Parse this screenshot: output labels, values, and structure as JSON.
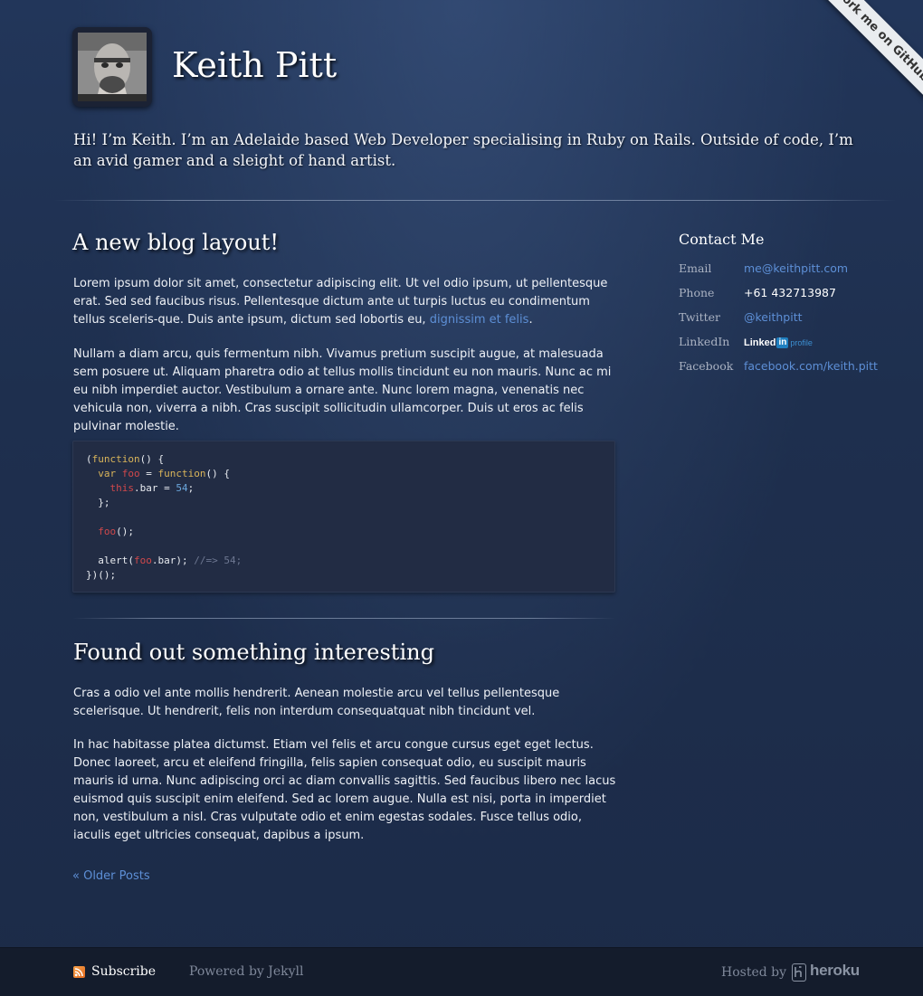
{
  "header": {
    "name": "Keith Pitt",
    "intro": "Hi! I’m Keith. I’m an Adelaide based Web Developer specialising in Ruby on Rails. Outside of code, I’m an avid gamer and a sleight of hand artist.",
    "fork_ribbon": "Fork me on GitHub"
  },
  "posts": [
    {
      "title": "A new blog layout!",
      "para1_text": "Lorem ipsum dolor sit amet, consectetur adipiscing elit. Ut vel odio ipsum, ut pellentesque erat. Sed sed faucibus risus. Pellentesque dictum ante ut turpis luctus eu condimentum tellus sceleris-que. Duis ante ipsum, dictum sed lobortis eu, ",
      "para1_link": "dignissim et felis",
      "para1_end": ".",
      "para2": "Nullam a diam arcu, quis fermentum nibh. Vivamus pretium suscipit augue, at malesuada sem posuere ut. Aliquam pharetra odio at tellus mollis tincidunt eu non mauris. Nunc ac mi eu nibh imperdiet auctor. Vestibulum a ornare ante. Nunc lorem magna, venenatis nec vehicula non, viverra a nibh. Cras suscipit sollicitudin ullamcorper. Duis ut eros ac felis pulvinar molestie."
    },
    {
      "title": "Found out something interesting",
      "para1": "Cras a odio vel ante mollis hendrerit. Aenean molestie arcu vel tellus pellentesque scelerisque. Ut hendrerit, felis non interdum consequatquat nibh tincidunt vel.",
      "para2": "In hac habitasse platea dictumst. Etiam vel felis et arcu congue cursus eget eget lectus. Donec laoreet, arcu et eleifend fringilla, felis sapien consequat odio, eu suscipit mauris mauris id urna. Nunc adipiscing orci ac diam convallis sagittis. Sed faucibus libero nec lacus euismod quis suscipit enim eleifend. Sed ac lorem augue. Nulla est nisi, porta in imperdiet non, vestibulum a nisl. Cras vulputate odio et enim egestas sodales. Fusce tellus odio, iaculis eget ultricies consequat, dapibus a ipsum."
    }
  ],
  "code": {
    "l1_open": "(",
    "l1_kw": "function",
    "l1_rest": "() {",
    "l2_kw": "var",
    "l2_var": "foo",
    "l2_eq": " = ",
    "l2_kw2": "function",
    "l2_rest": "() {",
    "l3_kw": "this",
    "l3_rest": ".bar = ",
    "l3_num": "54",
    "l3_end": ";",
    "l4": "};",
    "l6_var": "foo",
    "l6_rest": "();",
    "l8_a": "alert(",
    "l8_var": "foo",
    "l8_b": ".bar); ",
    "l8_cm": "//=> 54;",
    "l9": "})();"
  },
  "pagination": {
    "older": "« Older Posts"
  },
  "sidebar": {
    "title": "Contact Me",
    "email_label": "Email",
    "email_value": "me@keithpitt.com",
    "phone_label": "Phone",
    "phone_value": "+61 432713987",
    "twitter_label": "Twitter",
    "twitter_value": "@keithpitt",
    "linkedin_label": "LinkedIn",
    "linkedin_word": "Linked",
    "linkedin_in": "in",
    "linkedin_profile": "profile",
    "facebook_label": "Facebook",
    "facebook_value": "facebook.com/keith.pitt"
  },
  "footer": {
    "subscribe": "Subscribe",
    "powered": "Powered by Jekyll",
    "hosted": "Hosted by",
    "heroku": "heroku"
  },
  "colors": {
    "background": "#1f3050",
    "link": "#5d8fd6",
    "footer_bg": "#141c2c",
    "code_bg": "#222c44"
  }
}
